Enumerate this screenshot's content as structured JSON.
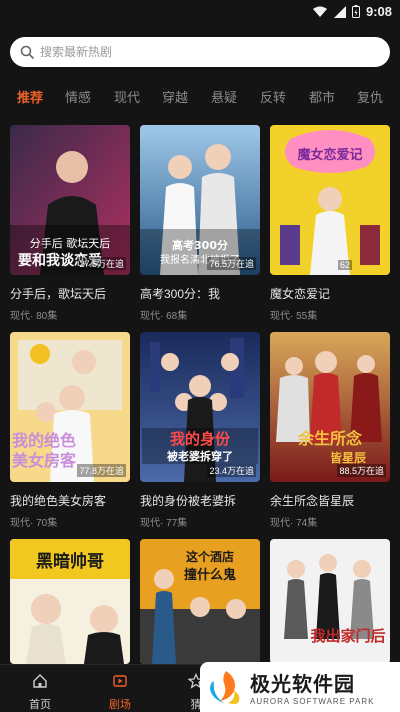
{
  "status": {
    "time": "9:08"
  },
  "search": {
    "placeholder": "搜索最新热剧"
  },
  "tabs": [
    {
      "label": "推荐",
      "active": true
    },
    {
      "label": "情感"
    },
    {
      "label": "现代"
    },
    {
      "label": "穿越"
    },
    {
      "label": "悬疑"
    },
    {
      "label": "反转"
    },
    {
      "label": "都市"
    },
    {
      "label": "复仇"
    }
  ],
  "dramas": [
    {
      "title": "分手后，歌坛天后",
      "genre": "现代",
      "episodes": "80集",
      "views": "27.5万在追",
      "poster_text": "分手后被歌坛天后要和我谈恋爱",
      "colors": [
        "#3a2a4a",
        "#b03060"
      ]
    },
    {
      "title": "高考300分：我",
      "genre": "现代",
      "episodes": "68集",
      "views": "76.5万在追",
      "poster_text": "高考300分我报名清北被拒了",
      "colors": [
        "#2a5a8a",
        "#9fc8e8"
      ]
    },
    {
      "title": "魔女恋爱记",
      "genre": "现代",
      "episodes": "55集",
      "views": "62",
      "poster_text": "魔女恋爱记",
      "colors": [
        "#f2d22a",
        "#ff8fc0"
      ]
    },
    {
      "title": "我的绝色美女房客",
      "genre": "现代",
      "episodes": "70集",
      "views": "77.8万在追",
      "poster_text": "我的绝色美女房客",
      "colors": [
        "#f6d98a",
        "#c98fd8"
      ]
    },
    {
      "title": "我的身份被老婆拆",
      "genre": "现代",
      "episodes": "77集",
      "views": "23.4万在追",
      "poster_text": "我的身份被老婆拆穿了",
      "colors": [
        "#1a2a5a",
        "#4a6aa8"
      ]
    },
    {
      "title": "余生所念皆星辰",
      "genre": "现代",
      "episodes": "74集",
      "views": "88.5万在追",
      "poster_text": "余生所念皆星辰",
      "colors": [
        "#7a1a1a",
        "#d8a85a"
      ]
    },
    {
      "title": "",
      "genre": "",
      "episodes": "",
      "views": "",
      "poster_text": "黑暗帅哥",
      "colors": [
        "#f0c820",
        "#f6f0e0"
      ]
    },
    {
      "title": "",
      "genre": "",
      "episodes": "",
      "views": "",
      "poster_text": "这个酒店撞什么鬼",
      "colors": [
        "#e8a020",
        "#3a3a3a"
      ]
    },
    {
      "title": "",
      "genre": "",
      "episodes": "",
      "views": "",
      "poster_text": "我出家门后",
      "colors": [
        "#f2f2f2",
        "#8a8a8a"
      ]
    }
  ],
  "bottom_nav": [
    {
      "label": "首页",
      "icon": "home-icon"
    },
    {
      "label": "剧场",
      "icon": "theater-icon",
      "active": true
    },
    {
      "label": "猜",
      "icon": "star-icon"
    }
  ],
  "watermark": {
    "title": "极光软件园",
    "subtitle": "AURORA SOFTWARE PARK",
    "brand_colors": [
      "#ff7a1a",
      "#1aa8e8"
    ]
  },
  "accent_color": "#f0602a"
}
